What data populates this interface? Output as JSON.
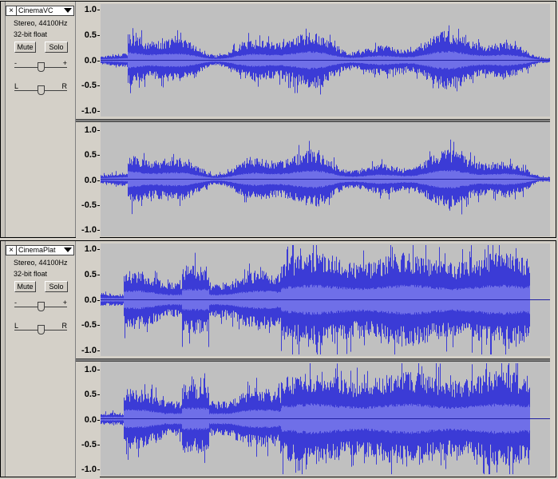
{
  "tracks": [
    {
      "name": "CinemaVC",
      "format": "Stereo, 44100Hz",
      "bitdepth": "32-bit float",
      "mute_label": "Mute",
      "solo_label": "Solo",
      "gain_minus": "-",
      "gain_plus": "+",
      "pan_left": "L",
      "pan_right": "R",
      "gain_level": 0.5,
      "pan_level": 0.5,
      "channels": [
        {
          "ticks": [
            "1.0",
            "0.5",
            "0.0",
            "-0.5",
            "-1.0"
          ]
        },
        {
          "ticks": [
            "1.0",
            "0.5",
            "0.0",
            "-0.5",
            "-1.0"
          ]
        }
      ]
    },
    {
      "name": "CinemaPlat",
      "format": "Stereo, 44100Hz",
      "bitdepth": "32-bit float",
      "mute_label": "Mute",
      "solo_label": "Solo",
      "gain_minus": "-",
      "gain_plus": "+",
      "pan_left": "L",
      "pan_right": "R",
      "gain_level": 0.5,
      "pan_level": 0.5,
      "channels": [
        {
          "ticks": [
            "1.0",
            "0.5",
            "0.0",
            "-0.5",
            "-1.0"
          ]
        },
        {
          "ticks": [
            "1.0",
            "0.5",
            "0.0",
            "-0.5",
            "-1.0"
          ]
        }
      ]
    }
  ],
  "colors": {
    "wave_peak": "#3b3bd6",
    "wave_rms": "#6f6fe8",
    "wave_bg": "#c0c0c0",
    "center_line": "#2020a0"
  },
  "icons": {
    "close": "close-icon",
    "menu": "chevron-down-icon",
    "slider": "slider-thumb-icon"
  }
}
